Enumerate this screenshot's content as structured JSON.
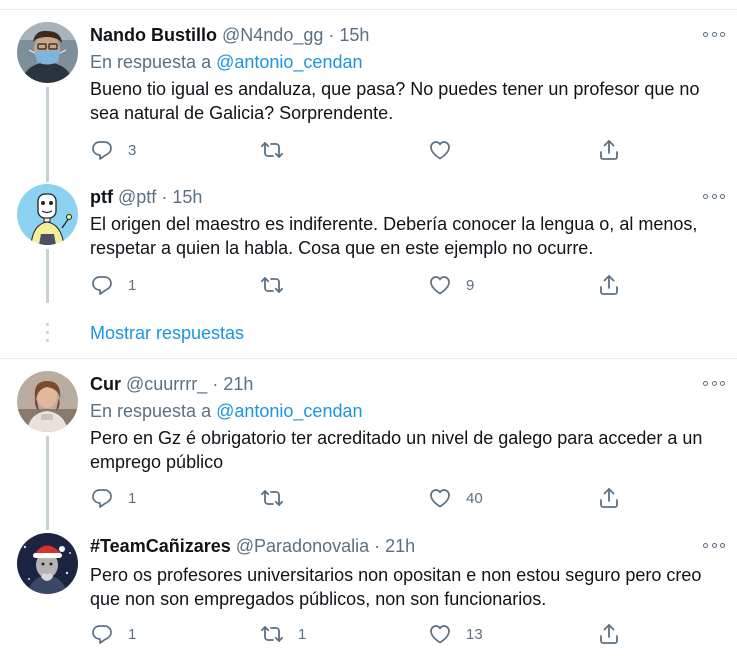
{
  "tweets": [
    {
      "name": "Nando Bustillo",
      "handle": "@N4ndo_gg",
      "time": "15h",
      "reply_prefix": "En respuesta a",
      "reply_to": "@antonio_cendan",
      "text": "Bueno tio igual es andaluza, que pasa? No puedes tener un profesor que no sea natural de Galicia? Sorprendente.",
      "replies": "3",
      "retweets": "",
      "likes": ""
    },
    {
      "name": "ptf",
      "handle": "@ptf",
      "time": "15h",
      "text": "El origen del maestro es indiferente. Debería conocer la lengua o, al menos, respetar a quien la habla. Cosa que en este ejemplo no ocurre.",
      "replies": "1",
      "retweets": "",
      "likes": "9"
    },
    {
      "name": "Cur",
      "handle": "@cuurrrr_",
      "time": "21h",
      "reply_prefix": "En respuesta a",
      "reply_to": "@antonio_cendan",
      "text": "Pero en Gz é obrigatorio ter acreditado un nivel de galego para acceder a un emprego público",
      "replies": "1",
      "retweets": "",
      "likes": "40"
    },
    {
      "name": "#TeamCañizares",
      "handle": "@Paradonovalia",
      "time": "21h",
      "text": "Pero os profesores universitarios non opositan e non estou seguro pero creo que non son empregados públicos, non son funcionarios.",
      "replies": "1",
      "retweets": "1",
      "likes": "13"
    }
  ],
  "show_more": "Mostrar respuestas",
  "middot": "·",
  "icons": [
    "reply-icon",
    "retweet-icon",
    "like-icon",
    "share-icon",
    "more-icon"
  ],
  "colors": {
    "link": "#1b95e0",
    "secondary": "#5b7083",
    "text": "#0f1419",
    "divider": "#e6ecf0",
    "thread": "#c4cfd6"
  }
}
